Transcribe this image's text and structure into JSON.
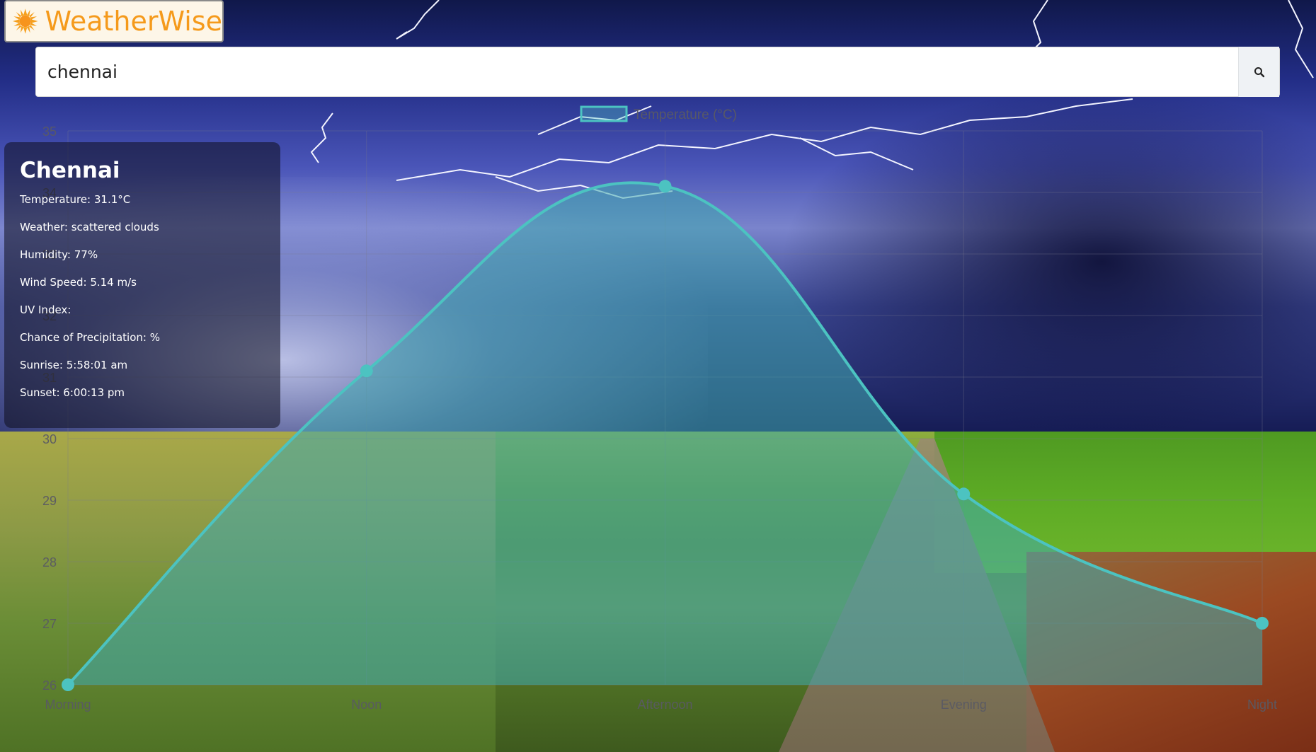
{
  "app": {
    "brand": "WeatherWise",
    "brand_color": "#f59a1b"
  },
  "search": {
    "value": "chennai",
    "icon": "search-icon"
  },
  "weather": {
    "city": "Chennai",
    "rows": [
      {
        "label": "Temperature:",
        "value": "31.1°C"
      },
      {
        "label": "Weather:",
        "value": "scattered clouds"
      },
      {
        "label": "Humidity:",
        "value": "77%"
      },
      {
        "label": "Wind Speed:",
        "value": "5.14 m/s"
      },
      {
        "label": "UV Index:",
        "value": ""
      },
      {
        "label": "Chance of Precipitation:",
        "value": "%"
      },
      {
        "label": "Sunrise:",
        "value": "5:58:01 am"
      },
      {
        "label": "Sunset:",
        "value": "6:00:13 pm"
      }
    ]
  },
  "chart_data": {
    "type": "line",
    "categories": [
      "Morning",
      "Noon",
      "Afternoon",
      "Evening",
      "Night"
    ],
    "series": [
      {
        "name": "Temperature (°C)",
        "values": [
          26,
          31.1,
          34.1,
          29.1,
          27
        ]
      }
    ],
    "ylim": [
      26,
      35
    ],
    "yticks": [
      26,
      27,
      28,
      29,
      30,
      31,
      32,
      33,
      34,
      35
    ],
    "fill": true,
    "smooth": true,
    "color": "#4cc3c1",
    "grid": true,
    "legend": "top"
  }
}
